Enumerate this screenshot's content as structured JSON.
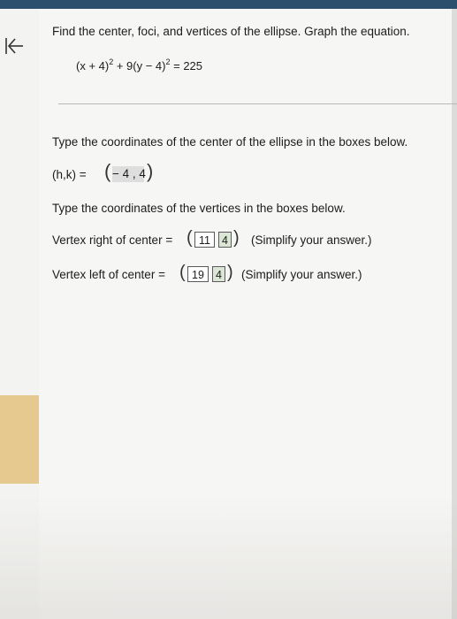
{
  "question": {
    "prompt": "Find the center, foci, and vertices of the ellipse. Graph the equation.",
    "equation": {
      "part1": "(x + 4)",
      "exp1": "2",
      "part2": " + 9(y − 4)",
      "exp2": "2",
      "part3": " = 225"
    }
  },
  "center_section": {
    "instruction": "Type the coordinates of the center of the ellipse in the boxes below.",
    "label": "(h,k) =",
    "value": "− 4 , 4",
    "open_paren": "(",
    "close_paren": ")"
  },
  "vertices_section": {
    "instruction": "Type the coordinates of the vertices in the boxes below.",
    "right": {
      "label": "Vertex right of center =",
      "x": "11",
      "y": "4",
      "hint": "(Simplify your answer.)"
    },
    "left": {
      "label": "Vertex left of center =",
      "x": "19",
      "y": "4",
      "hint": "(Simplify your answer.)"
    }
  },
  "colors": {
    "top_bar": "#2c4f6e",
    "rail_accent": "#e6c98f",
    "answer_fill": "#dbe6d4"
  },
  "icons": {
    "back": "back-to-start-icon"
  }
}
